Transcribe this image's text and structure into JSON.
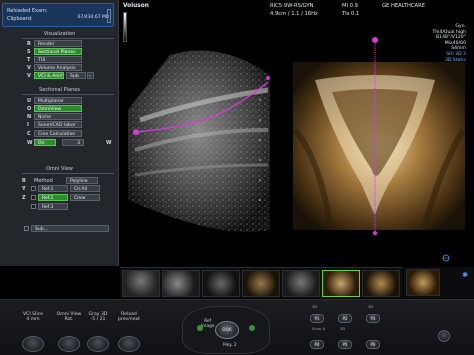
{
  "header": {
    "exam_label": "Reloaded Exam:",
    "clipboard_label": "Clipboard:",
    "clipboard_usage": "67/434.67 MB",
    "app_name": "Voluson",
    "probe_preset": "RIC5-9W-RS/GYN",
    "probe_params": "4.9cm / 1.1 / 16Hz",
    "mi": "MI  0.9",
    "tis": "TIs  0.1",
    "vendor": "GE HEALTHCARE"
  },
  "image_info": [
    "Gyn.",
    "Thi4/Qual high",
    "B148°/V120°",
    "Mix40/60",
    "S4mm",
    "SRI 3D 3",
    "3D Static"
  ],
  "visualization": {
    "title": "Visualization",
    "items": [
      {
        "key": "R",
        "label": "Render"
      },
      {
        "key": "S",
        "label": "Sectional Planes"
      },
      {
        "key": "T",
        "label": "TUI"
      },
      {
        "key": "V",
        "label": "Volume Analysis"
      },
      {
        "key": "V",
        "label": "VCI & Anim",
        "extra": "Sub",
        "extra2": "‹"
      }
    ]
  },
  "sectional": {
    "title": "Sectional Planes",
    "items": [
      {
        "key": "U",
        "label": "Multiplanar"
      },
      {
        "key": "O",
        "label": "OmniView"
      },
      {
        "key": "N",
        "label": "Niche"
      },
      {
        "key": "I",
        "label": "SonoVCAD labor"
      },
      {
        "key": "C",
        "label": "Cine Calculation"
      },
      {
        "key": "W",
        "label": "On",
        "value": "3"
      }
    ]
  },
  "omni": {
    "title": "Omni View",
    "method_label": "Method",
    "method_key": "R",
    "method_value": "Polyline",
    "refs": [
      {
        "key": "Y",
        "label": "Ref.1",
        "extra": "Clr.All"
      },
      {
        "key": "Z",
        "label": "Ref.2",
        "extra": "Clear"
      },
      {
        "key": "",
        "label": "Ref.3"
      }
    ],
    "sub_label": "Sub..."
  },
  "bottom": {
    "knobs": [
      {
        "label": "VCI Slice\n4 mm"
      },
      {
        "label": "Omni View\nRot."
      },
      {
        "label": "Gray 3D\n-5 / 21"
      },
      {
        "label": "Reload\nprev/next"
      }
    ],
    "center_labels": {
      "ref_image": "Ref\nImage",
      "poly": "Poly. 2"
    },
    "center_button": "DQ6",
    "right_buttons": [
      "P1",
      "P2",
      "P3",
      "P4",
      "P5",
      "P6"
    ],
    "right_small": [
      "3D",
      "Scan A",
      "3D",
      "3D"
    ]
  },
  "colors": {
    "green_button": "#2d8a2f",
    "selected_blue": "#19365a",
    "magenta_line": "#d23bd6"
  }
}
